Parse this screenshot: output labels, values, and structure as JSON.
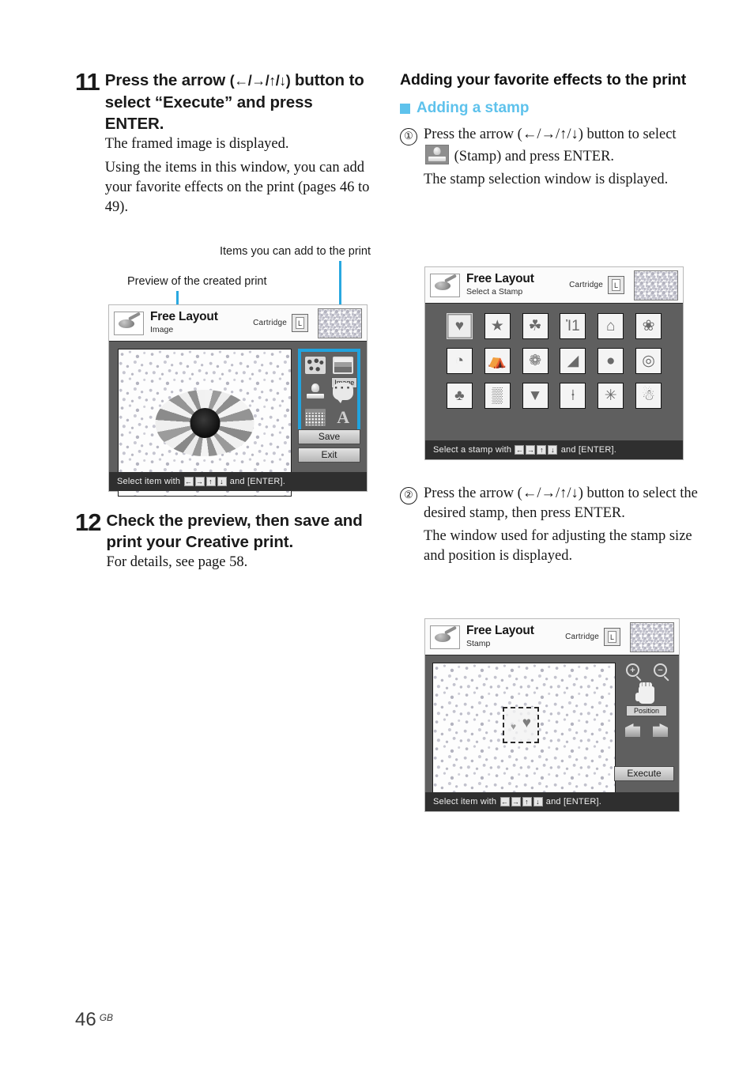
{
  "page": {
    "number": "46",
    "region": "GB"
  },
  "colors": {
    "accent_blue": "#29a8e0",
    "heading_blue": "#5ec2ec"
  },
  "left_column": {
    "step11": {
      "number": "11",
      "heading_a": "Press the arrow",
      "heading_arrows": "(←/→/↑/↓)",
      "heading_b": "button to select “Execute” and press ENTER.",
      "body": [
        "The framed image is displayed.",
        "Using the items in this window, you can add your favorite effects on the print (pages 46 to 49)."
      ]
    },
    "callouts": {
      "items": "Items you can add to the print",
      "preview": "Preview of the created print"
    },
    "step12": {
      "number": "12",
      "heading": "Check the preview, then save and print your Creative print.",
      "body": [
        "For details, see page 58."
      ]
    }
  },
  "right_column": {
    "section_heading": "Adding your favorite effects to the print",
    "sub_heading": "Adding a stamp",
    "items": [
      {
        "marker": "①",
        "lines": [
          "Press the arrow (←/→/↑/↓) button to select",
          "(Stamp) and press ENTER.",
          "The stamp selection window is displayed."
        ]
      },
      {
        "marker": "②",
        "lines": [
          "Press the arrow (←/→/↑/↓) button to select the desired stamp, then press ENTER.",
          "The window used for adjusting the stamp size and position is displayed."
        ]
      }
    ]
  },
  "screenshots": {
    "shot1": {
      "title": "Free Layout",
      "subtitle": "Image",
      "cartridge_label": "Cartridge",
      "cartridge_size": "L",
      "toolbar": [
        {
          "name": "frame",
          "label": ""
        },
        {
          "name": "image",
          "label": "Image"
        },
        {
          "name": "stamp",
          "label": ""
        },
        {
          "name": "message",
          "label": ""
        },
        {
          "name": "calendar",
          "label": ""
        },
        {
          "name": "text",
          "label": "A"
        }
      ],
      "buttons": [
        "Save",
        "Exit"
      ],
      "status": {
        "prefix": "Select item with",
        "keys": [
          "←",
          "→",
          "↑",
          "↓"
        ],
        "suffix": "and [ENTER]."
      }
    },
    "shot2": {
      "title": "Free Layout",
      "subtitle": "Select a Stamp",
      "cartridge_label": "Cartridge",
      "cartridge_size": "L",
      "stamps": [
        {
          "name": "hearts",
          "glyph": "♥",
          "selected": true
        },
        {
          "name": "shooting-star",
          "glyph": "★",
          "selected": false
        },
        {
          "name": "clover",
          "glyph": "☘",
          "selected": false
        },
        {
          "name": "gift",
          "glyph": "Ἰ1",
          "selected": false
        },
        {
          "name": "house",
          "glyph": "⌂",
          "selected": false
        },
        {
          "name": "flower",
          "glyph": "❀",
          "selected": false
        },
        {
          "name": "easter-eggs",
          "glyph": "◔",
          "selected": false
        },
        {
          "name": "tent",
          "glyph": "⛺",
          "selected": false
        },
        {
          "name": "maple-leaf",
          "glyph": "❁",
          "selected": false
        },
        {
          "name": "autumn-scene",
          "glyph": "◢",
          "selected": false
        },
        {
          "name": "pumpkin",
          "glyph": "●",
          "selected": false
        },
        {
          "name": "wreath",
          "glyph": "◎",
          "selected": false
        },
        {
          "name": "pine-tree",
          "glyph": "♣",
          "selected": false
        },
        {
          "name": "birthday-cake",
          "glyph": "▒",
          "selected": false
        },
        {
          "name": "candle",
          "glyph": "▼",
          "selected": false
        },
        {
          "name": "bell",
          "glyph": "⍿",
          "selected": false
        },
        {
          "name": "fireworks",
          "glyph": "✳",
          "selected": false
        },
        {
          "name": "snowman",
          "glyph": "☃",
          "selected": false
        }
      ],
      "status": {
        "prefix": "Select a stamp with",
        "keys": [
          "←",
          "→",
          "↑",
          "↓"
        ],
        "suffix": "and [ENTER]."
      }
    },
    "shot3": {
      "title": "Free Layout",
      "subtitle": "Stamp",
      "cartridge_label": "Cartridge",
      "cartridge_size": "L",
      "tools": [
        {
          "name": "zoom-in",
          "glyph": "+"
        },
        {
          "name": "zoom-out",
          "glyph": "−"
        },
        {
          "name": "position",
          "label": "Position"
        },
        {
          "name": "rotate-left",
          "glyph": ""
        },
        {
          "name": "rotate-right",
          "glyph": ""
        }
      ],
      "execute_label": "Execute",
      "status": {
        "prefix": "Select item with",
        "keys": [
          "←",
          "→",
          "↑",
          "↓"
        ],
        "suffix": "and [ENTER]."
      }
    }
  }
}
